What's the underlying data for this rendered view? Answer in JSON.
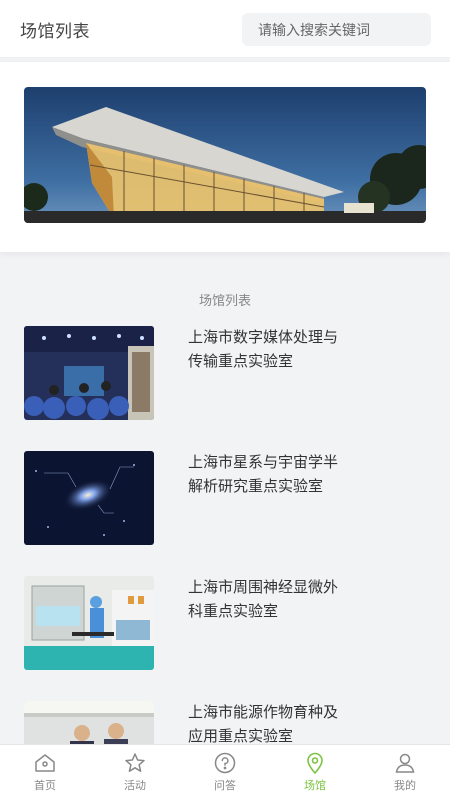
{
  "header": {
    "title": "场馆列表",
    "search_placeholder": "请输入搜索关键词"
  },
  "section": {
    "title": "场馆列表"
  },
  "venues": [
    {
      "name": "上海市数字媒体处理与传输重点实验室"
    },
    {
      "name": "上海市星系与宇宙学半解析研究重点实验室"
    },
    {
      "name": "上海市周围神经显微外科重点实验室"
    },
    {
      "name": "上海市能源作物育种及应用重点实验室"
    }
  ],
  "tabbar": {
    "active_color": "#7cc442",
    "items": [
      {
        "label": "首页",
        "icon": "home-icon"
      },
      {
        "label": "活动",
        "icon": "star-icon"
      },
      {
        "label": "问答",
        "icon": "question-icon"
      },
      {
        "label": "场馆",
        "icon": "location-pin-icon",
        "active": true
      },
      {
        "label": "我的",
        "icon": "user-icon"
      }
    ]
  }
}
